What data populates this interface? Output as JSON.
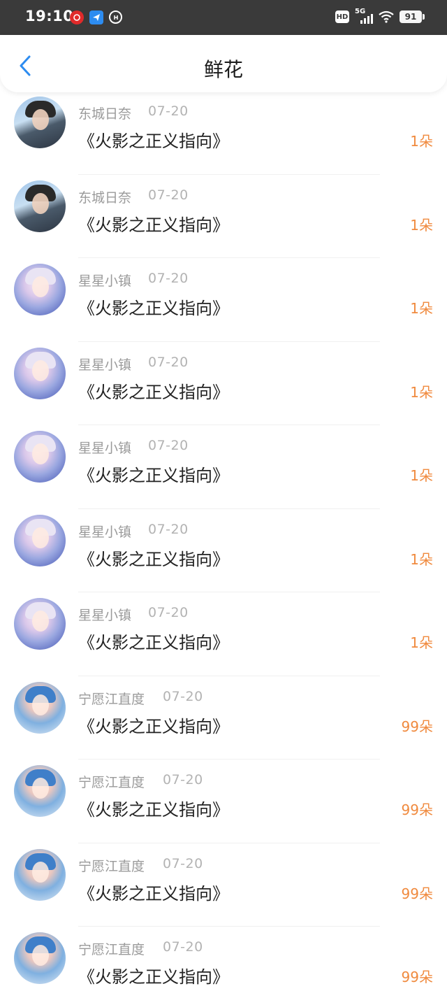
{
  "status_bar": {
    "time": "19:10",
    "battery": "91",
    "network": "5G",
    "hd": "HD"
  },
  "header": {
    "title": "鲜花"
  },
  "items": [
    {
      "user": "东城日奈",
      "date": "07-20",
      "title": "《火影之正义指向》",
      "count": "1朵",
      "avatar": "boy"
    },
    {
      "user": "东城日奈",
      "date": "07-20",
      "title": "《火影之正义指向》",
      "count": "1朵",
      "avatar": "boy"
    },
    {
      "user": "星星小镇",
      "date": "07-20",
      "title": "《火影之正义指向》",
      "count": "1朵",
      "avatar": "anime"
    },
    {
      "user": "星星小镇",
      "date": "07-20",
      "title": "《火影之正义指向》",
      "count": "1朵",
      "avatar": "anime"
    },
    {
      "user": "星星小镇",
      "date": "07-20",
      "title": "《火影之正义指向》",
      "count": "1朵",
      "avatar": "anime"
    },
    {
      "user": "星星小镇",
      "date": "07-20",
      "title": "《火影之正义指向》",
      "count": "1朵",
      "avatar": "anime"
    },
    {
      "user": "星星小镇",
      "date": "07-20",
      "title": "《火影之正义指向》",
      "count": "1朵",
      "avatar": "anime"
    },
    {
      "user": "宁愿江直度",
      "date": "07-20",
      "title": "《火影之正义指向》",
      "count": "99朵",
      "avatar": "girl"
    },
    {
      "user": "宁愿江直度",
      "date": "07-20",
      "title": "《火影之正义指向》",
      "count": "99朵",
      "avatar": "girl"
    },
    {
      "user": "宁愿江直度",
      "date": "07-20",
      "title": "《火影之正义指向》",
      "count": "99朵",
      "avatar": "girl"
    },
    {
      "user": "宁愿江直度",
      "date": "07-20",
      "title": "《火影之正义指向》",
      "count": "99朵",
      "avatar": "girl"
    }
  ],
  "colors": {
    "accent": "#2d8cf0",
    "count": "#f08a3e",
    "status_bar_bg": "#3a3a3a"
  },
  "icons": {
    "back": "chevron-left-icon"
  }
}
